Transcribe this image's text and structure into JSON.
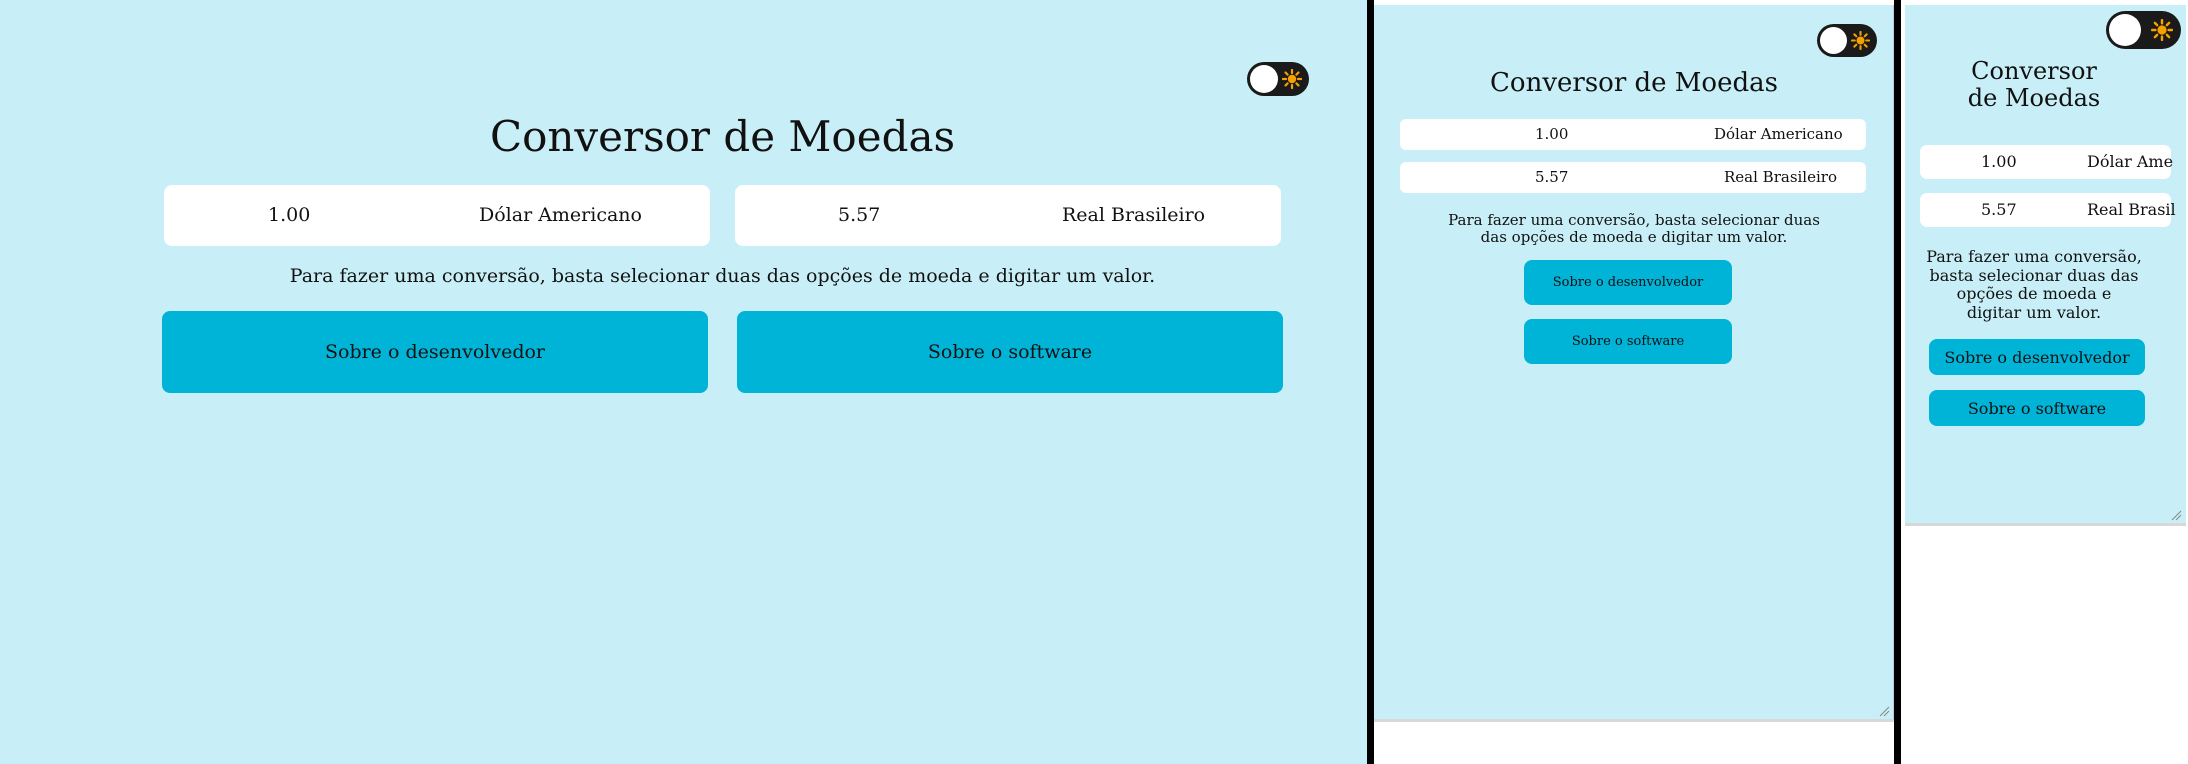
{
  "app": {
    "title": "Conversor de Moedas",
    "title_line1": "Conversor",
    "title_line2": "de Moedas",
    "from_value": "1.00",
    "from_currency": "Dólar Americano",
    "from_currency_truncated": "Dólar Ame",
    "to_value": "5.57",
    "to_currency": "Real Brasileiro",
    "to_currency_truncated": "Real Brasil",
    "hint": "Para fazer uma conversão, basta selecionar duas das opções de moeda e digitar um valor.",
    "hint_l1": "Para fazer uma conversão, basta selecionar duas",
    "hint_l2": "das opções de moeda e digitar um valor.",
    "hint_s1": "Para fazer uma conversão,",
    "hint_s2": "basta selecionar duas das",
    "hint_s3": "opções de moeda e",
    "hint_s4": "digitar um valor.",
    "about_dev_label": "Sobre o desenvolvedor",
    "about_software_label": "Sobre o software",
    "theme_toggle_icon": "sun-icon"
  },
  "colors": {
    "background": "#c8eff7",
    "button": "#00b4d8",
    "toggle_track": "#1a1a1a",
    "sun": "#f5a100"
  }
}
